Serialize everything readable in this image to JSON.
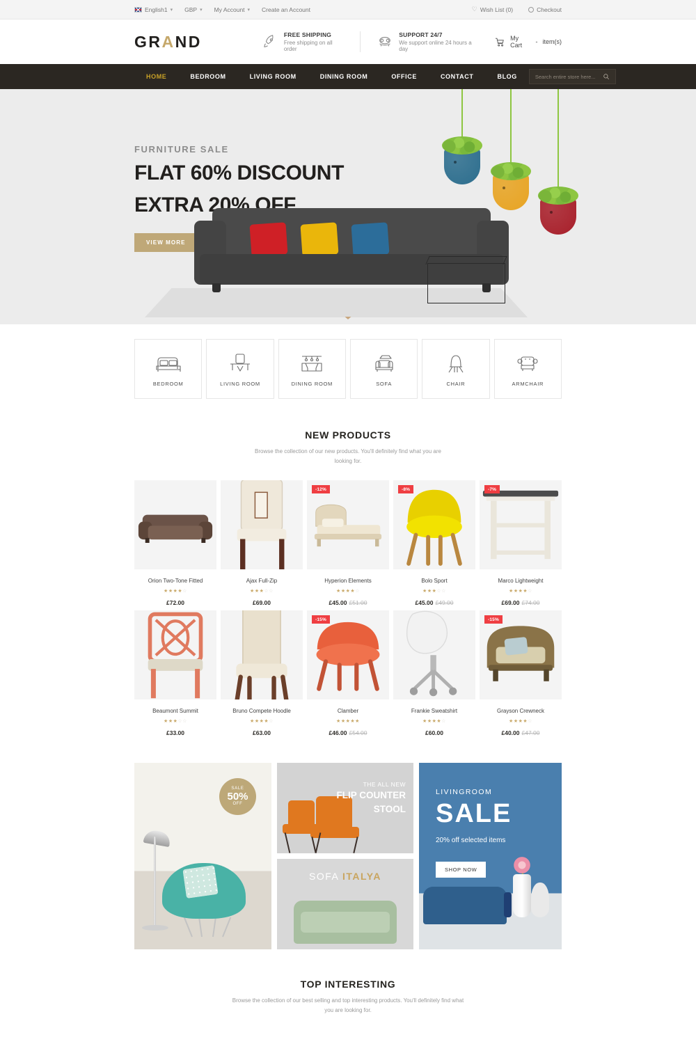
{
  "topbar": {
    "language": "English1",
    "currency": "GBP",
    "my_account": "My Account",
    "create_account": "Create an Account",
    "wishlist": "Wish List (0)",
    "checkout": "Checkout"
  },
  "header": {
    "logo_a": "GR",
    "logo_b": "A",
    "logo_c": "ND",
    "features": [
      {
        "icon": "rocket-icon",
        "title": "FREE SHIPPING",
        "subtitle": "Free shipping on all order"
      },
      {
        "icon": "phone-icon",
        "title": "SUPPORT 24/7",
        "subtitle": "We support online 24 hours a day"
      }
    ],
    "cart_label": "My Cart",
    "cart_sep": "-",
    "cart_count": "item(s)"
  },
  "nav": {
    "items": [
      {
        "label": "HOME",
        "active": true
      },
      {
        "label": "BEDROOM",
        "active": false
      },
      {
        "label": "LIVING ROOM",
        "active": false
      },
      {
        "label": "DINING ROOM",
        "active": false
      },
      {
        "label": "OFFICE",
        "active": false
      },
      {
        "label": "CONTACT",
        "active": false
      },
      {
        "label": "BLOG",
        "active": false
      }
    ],
    "search_placeholder": "Search entire store here..."
  },
  "hero": {
    "kicker": "FURNITURE SALE",
    "line1": "FLAT 60% DISCOUNT",
    "line2": "EXTRA 20% OFF",
    "button": "VIEW MORE",
    "pillow_colors": [
      "#cf2026",
      "#eab60b",
      "#2c6d9a"
    ],
    "planter_colors": [
      "#2d6e8e",
      "#e8a423",
      "#a81f2a"
    ],
    "bg": "#ececec"
  },
  "categories": [
    {
      "label": "BEDROOM",
      "icon": "bed-icon"
    },
    {
      "label": "LIVING ROOM",
      "icon": "desk-chair-icon"
    },
    {
      "label": "DINING ROOM",
      "icon": "dining-table-icon"
    },
    {
      "label": "SOFA",
      "icon": "sofa-icon"
    },
    {
      "label": "CHAIR",
      "icon": "chair-icon"
    },
    {
      "label": "ARMCHAIR",
      "icon": "armchair-icon"
    }
  ],
  "new_products": {
    "title": "NEW PRODUCTS",
    "subtitle": "Browse the collection of our new products. You'll definitely find what you are looking for.",
    "items": [
      {
        "name": "Orion Two-Tone Fitted",
        "price": "£72.00",
        "old_price": "",
        "badge": "",
        "rating": 4,
        "art": "sofa-brown"
      },
      {
        "name": "Ajax Full-Zip",
        "price": "£69.00",
        "old_price": "",
        "badge": "",
        "rating": 3,
        "art": "chair-cream"
      },
      {
        "name": "Hyperion Elements",
        "price": "£45.00",
        "old_price": "£51.00",
        "badge": "-12%",
        "rating": 4,
        "art": "bed-beige"
      },
      {
        "name": "Bolo Sport",
        "price": "£45.00",
        "old_price": "£49.00",
        "badge": "-8%",
        "rating": 3,
        "art": "chair-yellow"
      },
      {
        "name": "Marco Lightweight",
        "price": "£69.00",
        "old_price": "£74.00",
        "badge": "-7%",
        "rating": 4,
        "art": "table-white"
      },
      {
        "name": "Beaumont Summit",
        "price": "£33.00",
        "old_price": "",
        "badge": "",
        "rating": 3,
        "art": "chair-coral"
      },
      {
        "name": "Bruno Compete Hoodle",
        "price": "£63.00",
        "old_price": "",
        "badge": "",
        "rating": 4,
        "art": "chair-highback"
      },
      {
        "name": "Clamber",
        "price": "£46.00",
        "old_price": "£54.00",
        "badge": "-15%",
        "rating": 5,
        "art": "chair-orange"
      },
      {
        "name": "Frankie Sweatshirt",
        "price": "£60.00",
        "old_price": "",
        "badge": "",
        "rating": 4,
        "art": "office-white"
      },
      {
        "name": "Grayson Crewneck",
        "price": "£40.00",
        "old_price": "£47.00",
        "badge": "-15%",
        "rating": 4,
        "art": "armchair-wicker"
      }
    ]
  },
  "promos": {
    "left": {
      "badge_top": "SALE",
      "badge_mid": "50%",
      "badge_bot": "OFF"
    },
    "mid_top": {
      "kicker": "THE ALL NEW",
      "line1": "FLIP COUNTER",
      "line2": "STOOL"
    },
    "mid_bottom": {
      "word1": "SOFA",
      "word2": "ITALYA"
    },
    "right": {
      "kicker": "LIVINGROOM",
      "headline": "SALE",
      "subtitle": "20% off selected items",
      "button": "SHOP NOW"
    }
  },
  "top_interesting": {
    "title": "TOP INTERESTING",
    "subtitle": "Browse the collection of our best selling and top interesting products. You'll definitely find what you are looking for."
  }
}
